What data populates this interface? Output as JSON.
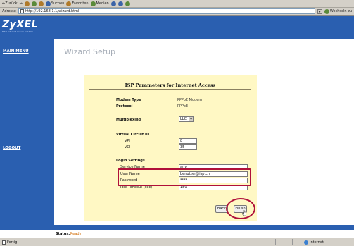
{
  "browser": {
    "toolbar": {
      "back": "⇐Zurück",
      "forward": "⇒",
      "search": "Suchen",
      "favorites": "Favoriten",
      "media": "Medien"
    },
    "address": {
      "label": "Adresse",
      "url": "http://192.168.1.1/wizard.html",
      "go": "Wechseln zu"
    },
    "status_left": "Fertig",
    "status_zone": "Internet"
  },
  "brand": {
    "logo": "ZyXEL",
    "tagline": "Total Internet Access Solution"
  },
  "nav": {
    "main_menu": "MAIN MENU",
    "logout": "LOGOUT"
  },
  "wizard": {
    "title": "Wizard Setup",
    "panel_title": "ISP Parameters for Internet Access",
    "modem_type_label": "Modem Type",
    "modem_type_value": "PPPoE Modem",
    "protocol_label": "Protocol",
    "protocol_value": "PPPoE",
    "multiplexing_label": "Multiplexing",
    "multiplexing_value": "LLC",
    "vc_heading": "Virtual Circuit ID",
    "vpi_label": "VPI",
    "vpi_value": "8",
    "vci_label": "VCI",
    "vci_value": "35",
    "login_heading": "Login Settings",
    "service_name_label": "Service Name",
    "service_name_value": "any",
    "username_label": "User Name",
    "username_value": "benutzer@isp.ch",
    "password_label": "Password",
    "password_value": "****",
    "idle_label": "Idle Timeout (sec)",
    "idle_value": "180",
    "back_button": "Back",
    "finish_button": "Finish"
  },
  "status": {
    "label": "Status:",
    "value": "Ready"
  },
  "colors": {
    "brand_blue": "#2a5fb0",
    "panel_bg": "#fff8c4",
    "highlight": "#b0103a"
  }
}
